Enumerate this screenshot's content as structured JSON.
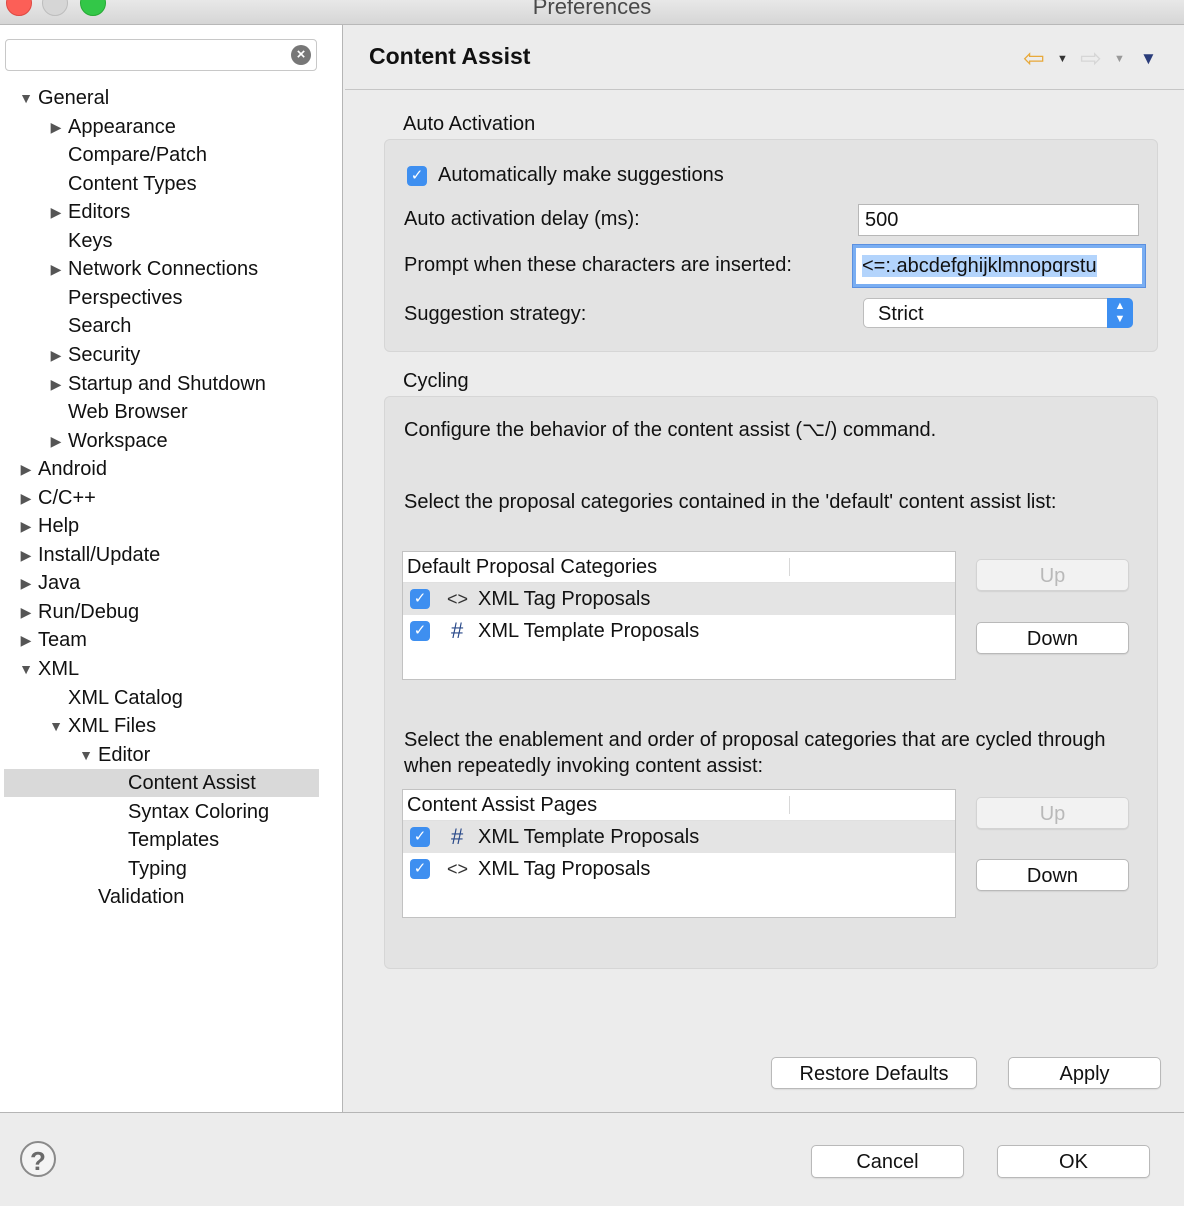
{
  "window": {
    "title": "Preferences"
  },
  "filter": {
    "value": "",
    "placeholder": ""
  },
  "tree": [
    {
      "label": "General",
      "indent": 0,
      "expander": "down"
    },
    {
      "label": "Appearance",
      "indent": 1,
      "expander": "right"
    },
    {
      "label": "Compare/Patch",
      "indent": 1,
      "expander": ""
    },
    {
      "label": "Content Types",
      "indent": 1,
      "expander": ""
    },
    {
      "label": "Editors",
      "indent": 1,
      "expander": "right"
    },
    {
      "label": "Keys",
      "indent": 1,
      "expander": ""
    },
    {
      "label": "Network Connections",
      "indent": 1,
      "expander": "right"
    },
    {
      "label": "Perspectives",
      "indent": 1,
      "expander": ""
    },
    {
      "label": "Search",
      "indent": 1,
      "expander": ""
    },
    {
      "label": "Security",
      "indent": 1,
      "expander": "right"
    },
    {
      "label": "Startup and Shutdown",
      "indent": 1,
      "expander": "right"
    },
    {
      "label": "Web Browser",
      "indent": 1,
      "expander": ""
    },
    {
      "label": "Workspace",
      "indent": 1,
      "expander": "right"
    },
    {
      "label": "Android",
      "indent": 0,
      "expander": "right"
    },
    {
      "label": "C/C++",
      "indent": 0,
      "expander": "right"
    },
    {
      "label": "Help",
      "indent": 0,
      "expander": "right"
    },
    {
      "label": "Install/Update",
      "indent": 0,
      "expander": "right"
    },
    {
      "label": "Java",
      "indent": 0,
      "expander": "right"
    },
    {
      "label": "Run/Debug",
      "indent": 0,
      "expander": "right"
    },
    {
      "label": "Team",
      "indent": 0,
      "expander": "right"
    },
    {
      "label": "XML",
      "indent": 0,
      "expander": "down"
    },
    {
      "label": "XML Catalog",
      "indent": 1,
      "expander": ""
    },
    {
      "label": "XML Files",
      "indent": 1,
      "expander": "down"
    },
    {
      "label": "Editor",
      "indent": 2,
      "expander": "down"
    },
    {
      "label": "Content Assist",
      "indent": 3,
      "expander": "",
      "selected": true
    },
    {
      "label": "Syntax Coloring",
      "indent": 3,
      "expander": ""
    },
    {
      "label": "Templates",
      "indent": 3,
      "expander": ""
    },
    {
      "label": "Typing",
      "indent": 3,
      "expander": ""
    },
    {
      "label": "Validation",
      "indent": 2,
      "expander": ""
    }
  ],
  "page": {
    "title": "Content Assist",
    "auto_activation": {
      "group_label": "Auto Activation",
      "auto_suggest": {
        "label": "Automatically make suggestions",
        "checked": true
      },
      "delay": {
        "label": "Auto activation delay (ms):",
        "value": "500"
      },
      "prompt_chars": {
        "label": "Prompt when these characters are inserted:",
        "value": "<=:.abcdefghijklmnopqrstu"
      },
      "strategy": {
        "label": "Suggestion strategy:",
        "value": "Strict"
      }
    },
    "cycling": {
      "group_label": "Cycling",
      "description": "Configure the behavior of the content assist (⌥/) command.",
      "default_list_text": "Select the proposal categories contained in the 'default' content assist list:",
      "default_table": {
        "header": "Default Proposal Categories",
        "rows": [
          {
            "icon": "<>",
            "icon_name": "xml-tag-icon",
            "label": "XML Tag Proposals",
            "checked": true
          },
          {
            "icon": "#",
            "icon_name": "template-hash-icon",
            "label": "XML Template Proposals",
            "checked": true
          }
        ]
      },
      "cycle_text": "Select the enablement and order of proposal categories that are cycled through when repeatedly invoking content assist:",
      "pages_table": {
        "header": "Content Assist Pages",
        "rows": [
          {
            "icon": "#",
            "icon_name": "template-hash-icon",
            "label": "XML Template Proposals",
            "checked": true
          },
          {
            "icon": "<>",
            "icon_name": "xml-tag-icon",
            "label": "XML Tag Proposals",
            "checked": true
          }
        ]
      },
      "up_label": "Up",
      "down_label": "Down"
    },
    "restore_label": "Restore Defaults",
    "apply_label": "Apply"
  },
  "footer": {
    "help_icon": "?",
    "cancel_label": "Cancel",
    "ok_label": "OK"
  },
  "colors": {
    "checkbox": "#3e8ff0",
    "selection": "#d9d9d9",
    "text_selection": "#b3d4fc",
    "back_arrow": "#e8a93a"
  }
}
